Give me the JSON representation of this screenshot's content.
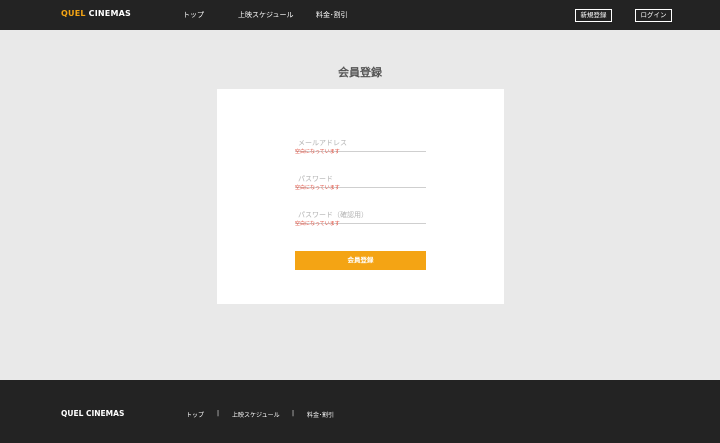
{
  "header": {
    "logo_accent": "QUEL",
    "logo_rest": " CINEMAS",
    "nav": [
      "トップ",
      "上映スケジュール",
      "料金･割引"
    ],
    "signup_label": "新規登録",
    "login_label": "ログイン"
  },
  "main": {
    "title": "会員登録",
    "fields": [
      {
        "placeholder": "メールアドレス",
        "error": "空白になっています"
      },
      {
        "placeholder": "パスワード",
        "error": "空白になっています"
      },
      {
        "placeholder": "パスワード（確認用）",
        "error": "空白になっています"
      }
    ],
    "submit_label": "会員登録"
  },
  "footer": {
    "logo": "QUEL CINEMAS",
    "links": [
      "トップ",
      "上映スケジュール",
      "料金･割引"
    ],
    "separator": "|"
  },
  "colors": {
    "accent": "#f4a414",
    "dark": "#232323",
    "background": "#e9e9e9",
    "error": "#e04a3a"
  }
}
